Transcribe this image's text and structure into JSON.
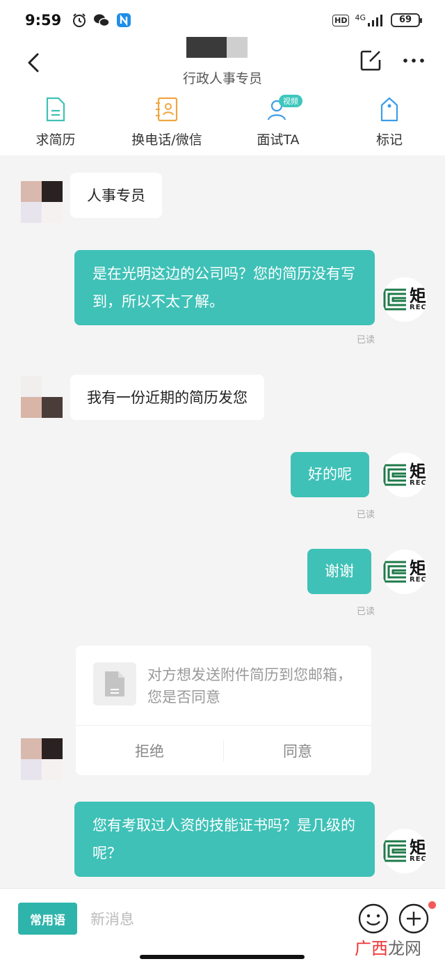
{
  "status_bar": {
    "time": "9:59",
    "hd": "HD",
    "network": "4G",
    "battery": "69"
  },
  "header": {
    "subtitle": "行政人事专员"
  },
  "actions": [
    {
      "label": "求简历",
      "icon": "resume-icon"
    },
    {
      "label": "换电话/微信",
      "icon": "contact-card-icon"
    },
    {
      "label": "面试TA",
      "icon": "interview-icon",
      "badge": "视频"
    },
    {
      "label": "标记",
      "icon": "tag-icon"
    }
  ],
  "messages": {
    "m1": "人事专员",
    "m2": "是在光明这边的公司吗？您的简历没有写到，所以不太了解。",
    "m2_status": "已读",
    "m3": "我有一份近期的简历发您",
    "m4": "好的呢",
    "m4_status": "已读",
    "m5": "谢谢",
    "m5_status": "已读",
    "m6": "您有考取过人资的技能证书吗？是几级的呢？"
  },
  "file_card": {
    "text": "对方想发送附件简历到您邮箱，您是否同意",
    "reject": "拒绝",
    "accept": "同意"
  },
  "input_bar": {
    "phrase_button": "常用语",
    "placeholder": "新消息"
  },
  "self_avatar": {
    "logo_char": "矩",
    "logo_sub": "REC"
  },
  "watermark": {
    "part1": "广西",
    "part2": "龙网"
  },
  "colors": {
    "accent": "#3fc1b7",
    "phrase_btn": "#2fb4ac",
    "notice_dot": "#f25a5a"
  }
}
